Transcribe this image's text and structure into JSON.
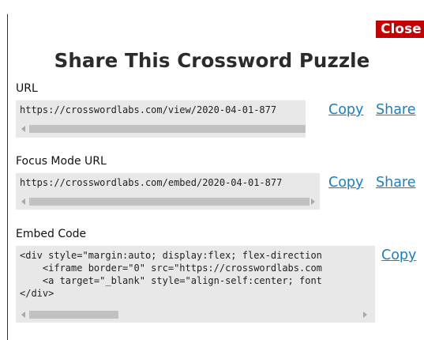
{
  "dialog": {
    "close_label": "Close",
    "title": "Share This Crossword Puzzle"
  },
  "url_section": {
    "label": "URL",
    "value": "https://crosswordlabs.com/view/2020-04-01-877",
    "copy_label": "Copy",
    "share_label": "Share"
  },
  "focus_section": {
    "label": "Focus Mode URL",
    "value": "https://crosswordlabs.com/embed/2020-04-01-877",
    "copy_label": "Copy",
    "share_label": "Share"
  },
  "embed_section": {
    "label": "Embed Code",
    "lines": [
      "<div style=\"margin:auto; display:flex; flex-direction",
      "    <iframe border=\"0\" src=\"https://crosswordlabs.com",
      "    <a target=\"_blank\" style=\"align-self:center; font",
      "</div>"
    ],
    "copy_label": "Copy"
  },
  "colors": {
    "close_bg": "#c40000",
    "link": "#1a7fc0",
    "code_bg": "#e8e8e8"
  }
}
